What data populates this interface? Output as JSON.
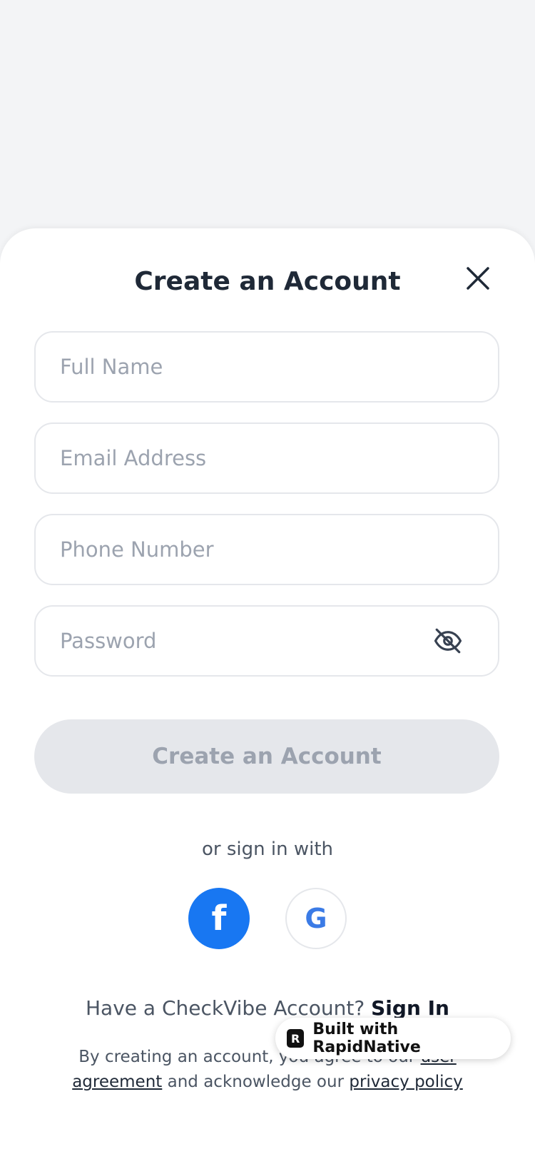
{
  "header": {
    "title": "Create an Account"
  },
  "form": {
    "full_name_placeholder": "Full Name",
    "email_placeholder": "Email Address",
    "phone_placeholder": "Phone Number",
    "password_placeholder": "Password",
    "submit_label": "Create an Account"
  },
  "social": {
    "label": "or sign in with",
    "facebook_glyph": "f",
    "google_glyph": "G"
  },
  "footer": {
    "have_account_text": "Have a CheckVibe Account?",
    "sign_in_label": "Sign In",
    "legal_prefix": "By creating an account, you agree to our",
    "user_agreement_link": "user agreement",
    "legal_middle": "and acknowledge our",
    "privacy_policy_link": "privacy policy"
  },
  "badge": {
    "logo_glyph": "R",
    "text": "Built with RapidNative"
  },
  "colors": {
    "background": "#f3f4f6",
    "facebook": "#1877f2",
    "google": "#3b7be6",
    "disabled_button": "#e5e7eb",
    "disabled_text": "#9ca3af"
  }
}
